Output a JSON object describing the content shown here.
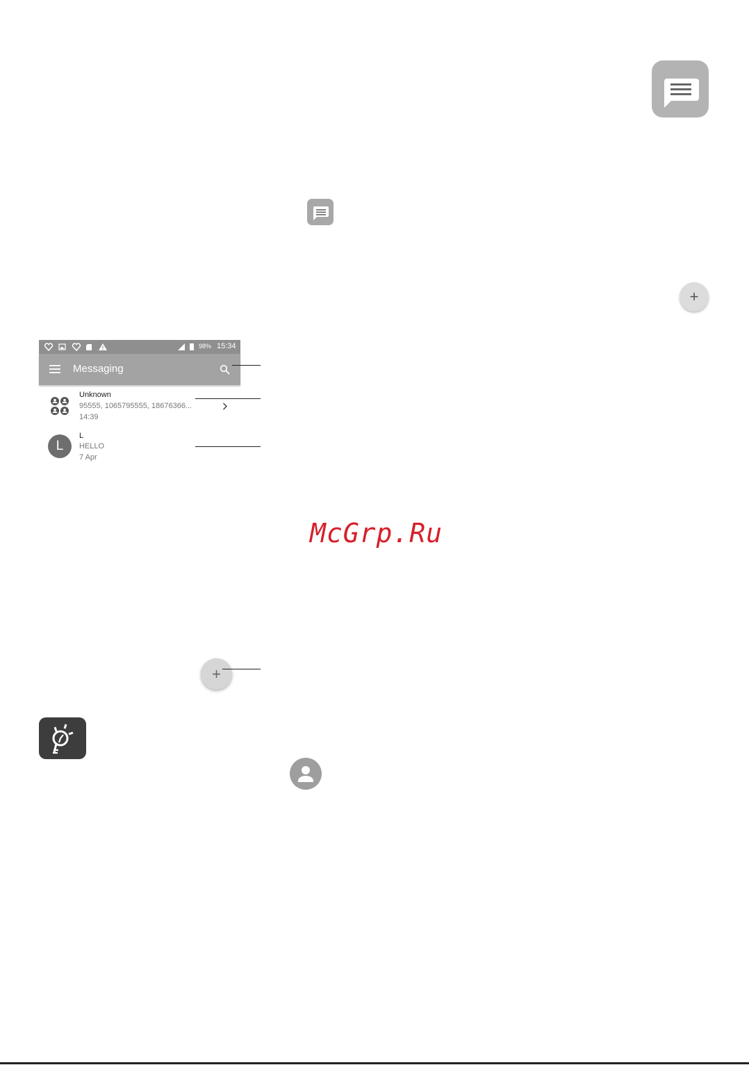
{
  "phone": {
    "status": {
      "battery": "98%",
      "time": "15:34"
    },
    "toolbar": {
      "title": "Messaging"
    },
    "conversations": [
      {
        "name": "Unknown",
        "preview": "95555, 1065795555, 18676366...",
        "time": "14:39"
      },
      {
        "name": "L",
        "avatar_letter": "L",
        "preview": "HELLO",
        "time": "7 Apr"
      }
    ]
  },
  "fab": {
    "symbol": "+"
  },
  "watermark": "McGrp.Ru",
  "icons": {
    "app": "messaging-app-icon",
    "inline": "message-icon",
    "tip": "lightbulb-tip-icon",
    "contact": "contact-person-icon"
  }
}
